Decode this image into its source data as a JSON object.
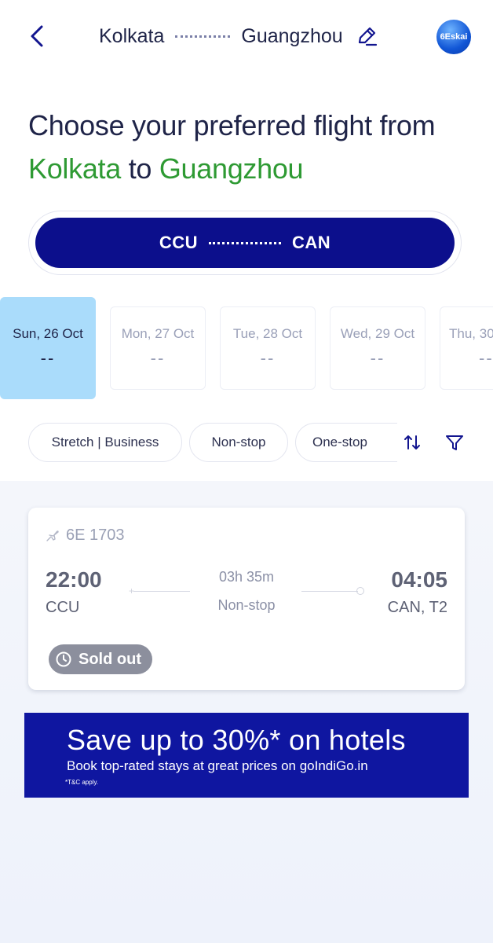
{
  "header": {
    "origin": "Kolkata",
    "destination": "Guangzhou",
    "avatar_text": "6Eskai"
  },
  "headline": {
    "line1": "Choose your preferred flight from",
    "origin": "Kolkata",
    "connector": "to",
    "destination": "Guangzhou"
  },
  "route": {
    "from_code": "CCU",
    "to_code": "CAN"
  },
  "dates": [
    {
      "label": "Sun, 26 Oct",
      "price": "--",
      "selected": true
    },
    {
      "label": "Mon, 27 Oct",
      "price": "--"
    },
    {
      "label": "Tue, 28 Oct",
      "price": "--"
    },
    {
      "label": "Wed, 29 Oct",
      "price": "--"
    },
    {
      "label": "Thu, 30",
      "price": "--"
    }
  ],
  "filters": {
    "chips": [
      "Stretch | Business",
      "Non-stop",
      "One-stop"
    ],
    "sort_icon": "sort-icon",
    "filter_icon": "filter-funnel-icon"
  },
  "flight": {
    "number": "6E 1703",
    "dep_time": "22:00",
    "dep_code": "CCU",
    "duration": "03h 35m",
    "stops": "Non-stop",
    "arr_time": "04:05",
    "arr_code": "CAN, T2",
    "status": "Sold out"
  },
  "banner": {
    "title": "Save up to 30%* on hotels",
    "subtitle": "Book top-rated stays at great prices on goIndiGo.in",
    "note": "*T&C apply."
  },
  "colors": {
    "brand_navy": "#0c0f8c",
    "accent_green": "#2e9a33",
    "selected_date": "#aadcfb",
    "sold_out": "#8c8f9d"
  }
}
